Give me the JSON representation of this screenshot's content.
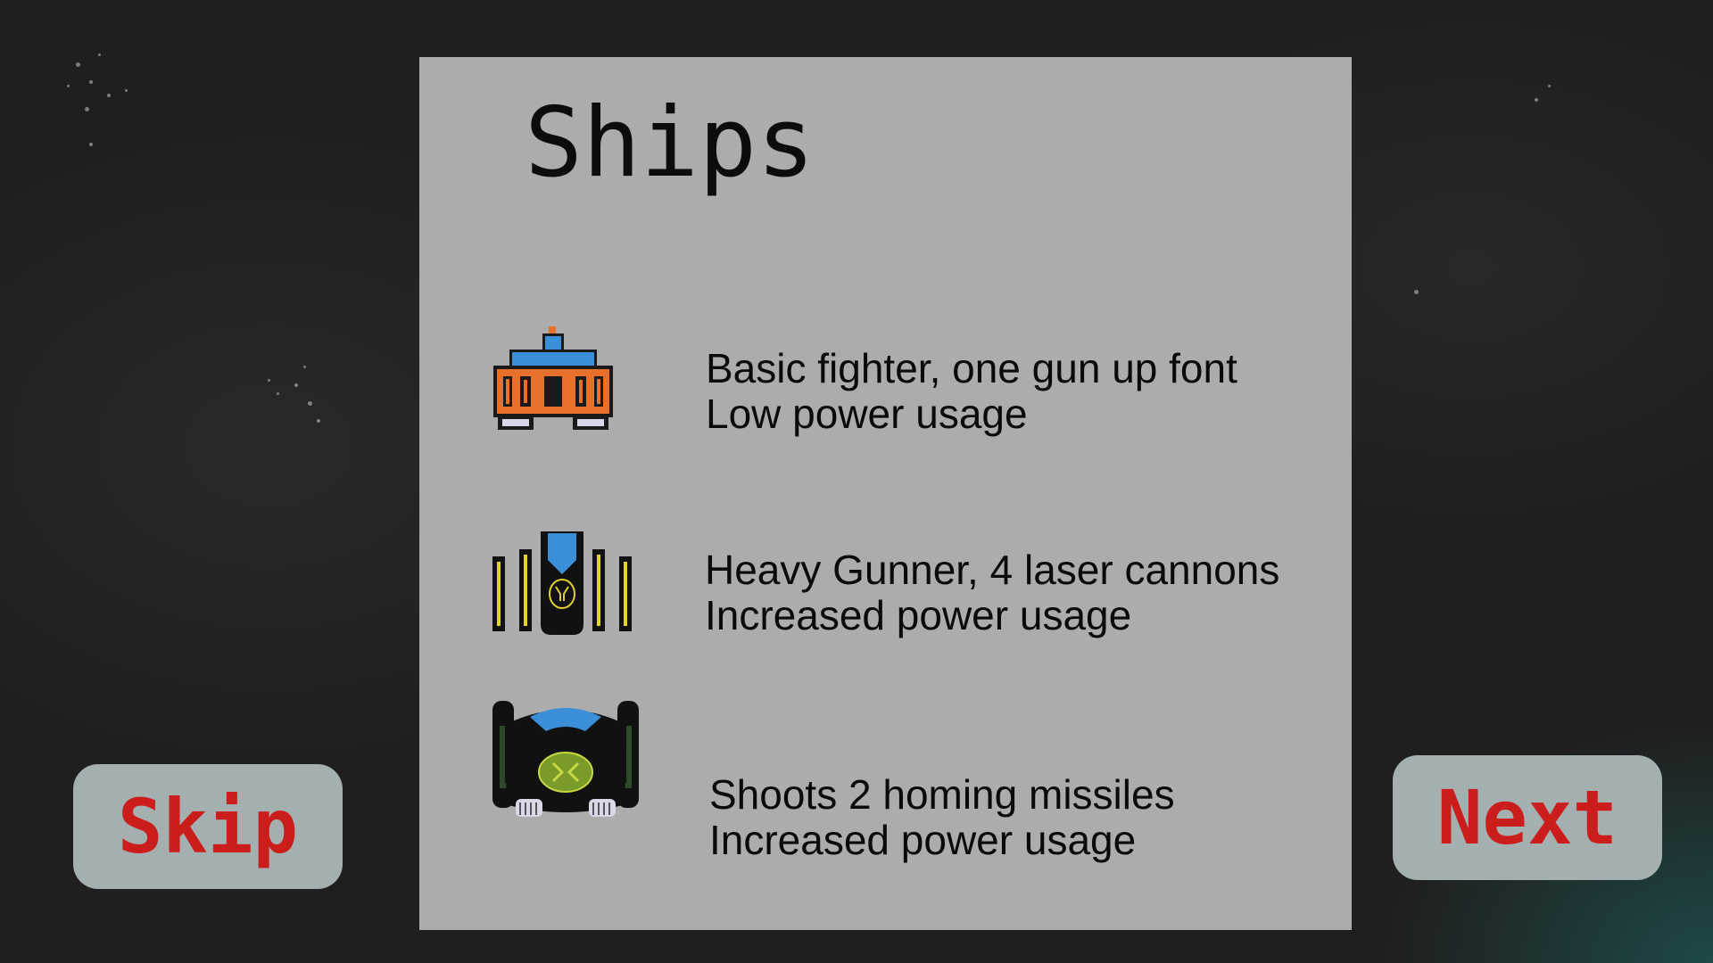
{
  "screen": {
    "title": "Ships"
  },
  "ships": [
    {
      "icon": "basic-fighter-ship-icon",
      "line1": "Basic fighter, one gun up font",
      "line2": "Low power usage"
    },
    {
      "icon": "heavy-gunner-ship-icon",
      "line1": "Heavy Gunner, 4 laser cannons",
      "line2": "Increased power usage"
    },
    {
      "icon": "homing-missile-ship-icon",
      "line1": "Shoots 2 homing missiles",
      "line2": "Increased power usage"
    }
  ],
  "buttons": {
    "skip_label": "Skip",
    "next_label": "Next"
  },
  "colors": {
    "button_text": "#cc1d1d",
    "panel": "#acacac",
    "background": "#1f1f1f"
  }
}
